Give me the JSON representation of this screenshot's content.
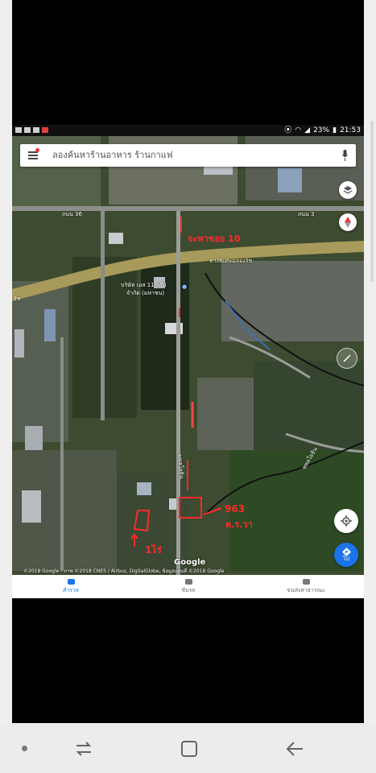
{
  "status_bar": {
    "battery": "23%",
    "time": "21:53"
  },
  "search": {
    "placeholder": "ลองค้นหาร้านอาหาร ร้านกาแฟ"
  },
  "map": {
    "labels": {
      "road_top": "ถนน 36",
      "road_top_right": "ถนน 3",
      "expressway": "ทางพิเศษฉลองรัช",
      "expressway_left": "รัช",
      "company_line1": "บริษัท เอส 11 กรุ๊ป",
      "company_line2": "จำกัด (มหาชน)",
      "side_road": "พหลโยธิน",
      "side_road_right": "พหลโยธิน"
    },
    "annotations": {
      "soi_label": "จะหาซอย 10",
      "plot_label": "963",
      "deed_label": "ต.ร.วา",
      "rai_label": "1ไร่"
    },
    "google_logo": "Google",
    "attribution": "©2018 Google - ภาพ ©2018 CNES / Airbus, DigitalGlobe, ข้อมูลแผนที่ ©2018 Google",
    "go_label": "ไป"
  },
  "tabs": [
    {
      "label": "สำรวจ",
      "active": true
    },
    {
      "label": "ขับรถ",
      "active": false
    },
    {
      "label": "ขนส่งสาธารณะ",
      "active": false
    }
  ],
  "colors": {
    "accent": "#1a73e8",
    "annotation": "#ff2a2a",
    "expressway": "#a89a5a"
  }
}
